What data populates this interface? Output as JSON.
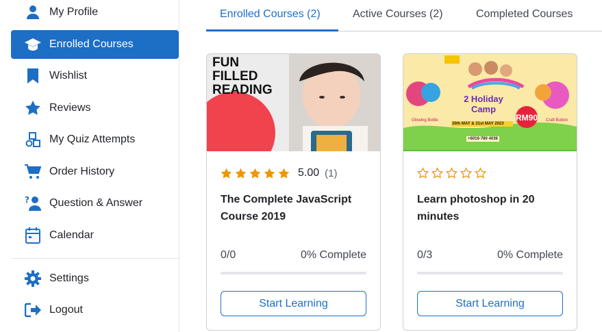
{
  "sidebar": {
    "items": [
      {
        "label": "My Profile",
        "icon": "user-icon"
      },
      {
        "label": "Enrolled Courses",
        "icon": "graduation-cap-icon"
      },
      {
        "label": "Wishlist",
        "icon": "bookmark-icon"
      },
      {
        "label": "Reviews",
        "icon": "star-icon"
      },
      {
        "label": "My Quiz Attempts",
        "icon": "shapes-icon"
      },
      {
        "label": "Order History",
        "icon": "cart-icon"
      },
      {
        "label": "Question & Answer",
        "icon": "question-user-icon"
      },
      {
        "label": "Calendar",
        "icon": "calendar-icon"
      },
      {
        "label": "Settings",
        "icon": "gear-icon"
      },
      {
        "label": "Logout",
        "icon": "logout-icon"
      }
    ],
    "active_index": 1
  },
  "tabs": [
    {
      "label": "Enrolled Courses (2)",
      "active": true
    },
    {
      "label": "Active Courses (2)",
      "active": false
    },
    {
      "label": "Completed Courses",
      "active": false
    }
  ],
  "courses": [
    {
      "thumb_text": [
        "FUN",
        "FILLED",
        "READING"
      ],
      "rating_value": "5.00",
      "rating_count": "(1)",
      "stars_filled": 5,
      "title": "The Complete JavaScript Course 2019",
      "progress_count": "0/0",
      "progress_text": "0% Complete",
      "progress": 0,
      "button": "Start Learning"
    },
    {
      "thumb_text": {
        "banner": "2 Holiday Camp",
        "dates": "30th MAY & 31st MAY 2023",
        "price": "RM90",
        "left_item": "Glowing Bottle",
        "right_item": "Craft Button",
        "phone": "+6016-780 4036"
      },
      "rating_value": "",
      "rating_count": "",
      "stars_filled": 0,
      "title": "Learn photoshop in 20 minutes",
      "progress_count": "0/3",
      "progress_text": "0% Complete",
      "progress": 0,
      "button": "Start Learning"
    }
  ],
  "colors": {
    "accent": "#1d6ec5",
    "star": "#ed9700",
    "text": "#212327"
  }
}
